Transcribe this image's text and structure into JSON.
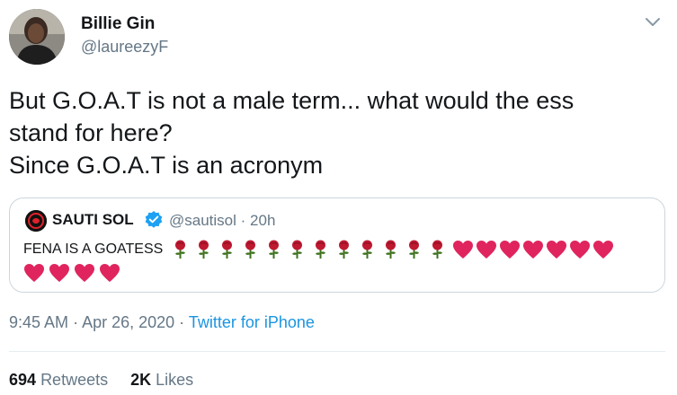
{
  "author": {
    "name": "Billie Gin",
    "handle": "@laureezyF"
  },
  "tweet": {
    "lines": [
      "But G.O.A.T is not a male term... what would the ess",
      "stand for here?",
      "Since G.O.A.T is an acronym"
    ],
    "time": "9:45 AM",
    "date": "Apr 26, 2020",
    "source": "Twitter for iPhone",
    "meta_separator": "·"
  },
  "quoted": {
    "name": "SAUTI SOL",
    "handle": "@sautisol",
    "age": "20h",
    "text": "FENA IS A GOATESS",
    "emoji_rose_count": 12,
    "emoji_heart_line1_count": 7,
    "emoji_heart_line2_count": 4
  },
  "stats": {
    "retweets_count": "694",
    "retweets_label": "Retweets",
    "likes_count": "2K",
    "likes_label": "Likes"
  },
  "colors": {
    "text": "#14171a",
    "secondary": "#657786",
    "link": "#1b95e0",
    "border": "#ccd6dd",
    "verified": "#1da1f2",
    "heart": "#e0245e",
    "rose": "#be1931",
    "stem": "#3e721d"
  },
  "icons": {
    "chevron": "chevron-down-icon",
    "verified": "verified-badge-icon",
    "rose": "rose-emoji",
    "heart": "red-heart-emoji"
  }
}
